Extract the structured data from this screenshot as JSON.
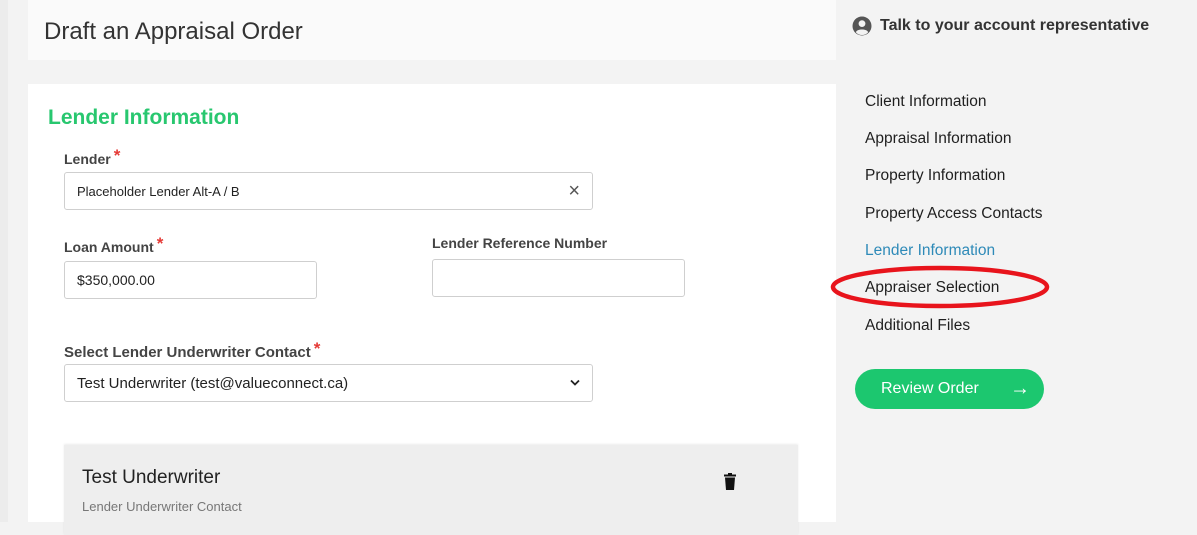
{
  "page": {
    "title": "Draft an Appraisal Order"
  },
  "support": {
    "label": "Talk to your account representative"
  },
  "section": {
    "title": "Lender Information"
  },
  "lender": {
    "label": "Lender",
    "required": "*",
    "value": "Placeholder Lender Alt-A / B",
    "clear_icon": "×"
  },
  "loan_amount": {
    "label": "Loan Amount",
    "required": "*",
    "value": "$350,000.00"
  },
  "reference": {
    "label": "Lender Reference Number",
    "value": ""
  },
  "underwriter_select": {
    "label": "Select Lender Underwriter Contact",
    "required": "*",
    "value": "Test Underwriter (test@valueconnect.ca)"
  },
  "contact_card": {
    "name": "Test Underwriter",
    "role": "Lender Underwriter Contact"
  },
  "nav": {
    "items": [
      {
        "label": "Client Information",
        "active": false
      },
      {
        "label": "Appraisal Information",
        "active": false
      },
      {
        "label": "Property Information",
        "active": false
      },
      {
        "label": "Property Access Contacts",
        "active": false
      },
      {
        "label": "Lender Information",
        "active": true
      },
      {
        "label": "Appraiser Selection",
        "active": false
      },
      {
        "label": "Additional Files",
        "active": false
      }
    ]
  },
  "review_button": {
    "label": "Review Order",
    "arrow": "→"
  },
  "colors": {
    "accent_green": "#28c76f",
    "button_green": "#1cc76f",
    "active_link": "#2e8ab8",
    "required": "#e53935",
    "annotation_red": "#e8141c"
  }
}
